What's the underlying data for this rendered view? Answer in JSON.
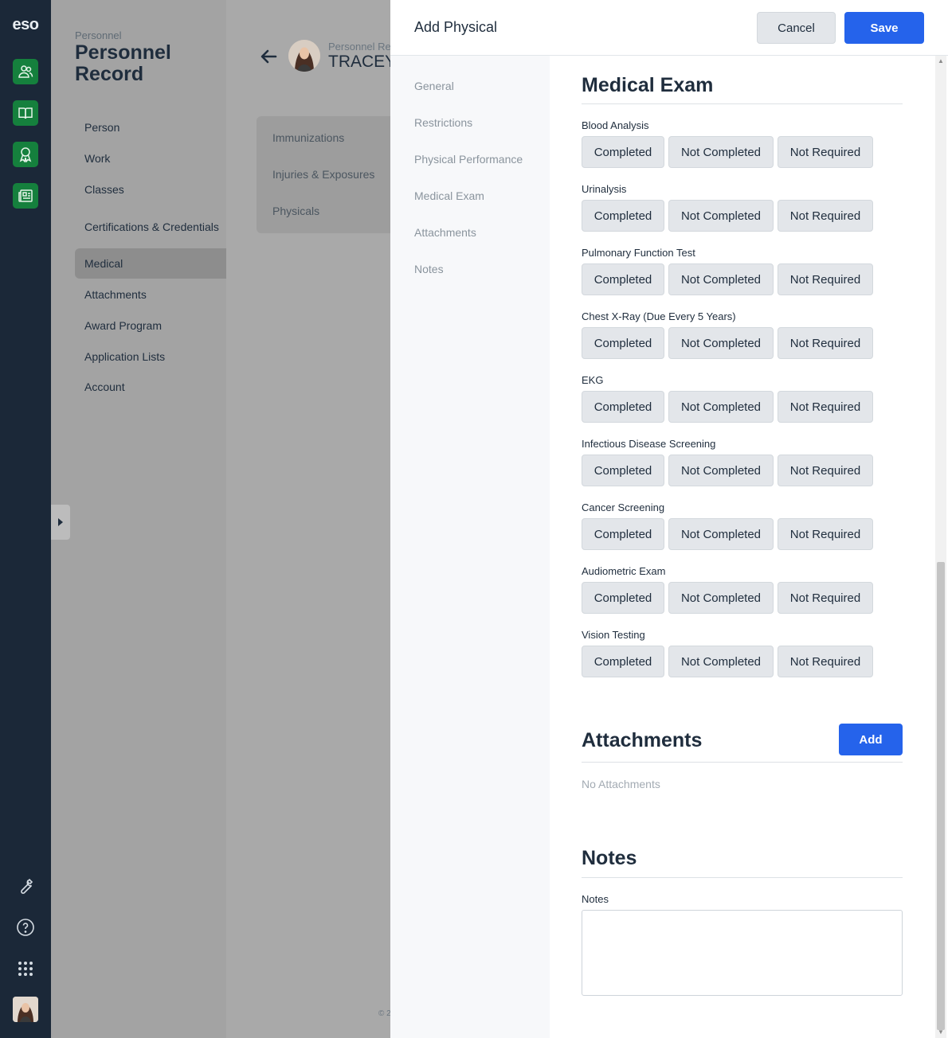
{
  "rail": {
    "logo": "eso",
    "apps": [
      "people-icon",
      "book-icon",
      "award-icon",
      "newspaper-icon"
    ],
    "utilities": [
      "wrench-icon",
      "help-icon",
      "apps-grid-icon"
    ]
  },
  "background_page": {
    "breadcrumb": "Personnel",
    "title": "Personnel Record",
    "nav": [
      "Person",
      "Work",
      "Classes",
      "Certifications & Credentials",
      "Medical",
      "Attachments",
      "Award Program",
      "Application Lists",
      "Account"
    ],
    "active_nav": "Medical",
    "header_sub": "Personnel Re",
    "header_name": "TRACEY",
    "subnav": [
      "Immunizations",
      "Injuries & Exposures",
      "Physicals"
    ],
    "footer": "© 2"
  },
  "drawer": {
    "title": "Add Physical",
    "cancel_label": "Cancel",
    "save_label": "Save",
    "nav": [
      "General",
      "Restrictions",
      "Physical Performance",
      "Medical Exam",
      "Attachments",
      "Notes"
    ],
    "medical_exam": {
      "title": "Medical Exam",
      "options": [
        "Completed",
        "Not Completed",
        "Not Required"
      ],
      "tests": [
        "Blood Analysis",
        "Urinalysis",
        "Pulmonary Function Test",
        "Chest X-Ray (Due Every 5 Years)",
        "EKG",
        "Infectious Disease Screening",
        "Cancer Screening",
        "Audiometric Exam",
        "Vision Testing"
      ]
    },
    "attachments": {
      "title": "Attachments",
      "add_label": "Add",
      "empty_text": "No Attachments"
    },
    "notes": {
      "title": "Notes",
      "field_label": "Notes",
      "value": ""
    }
  }
}
